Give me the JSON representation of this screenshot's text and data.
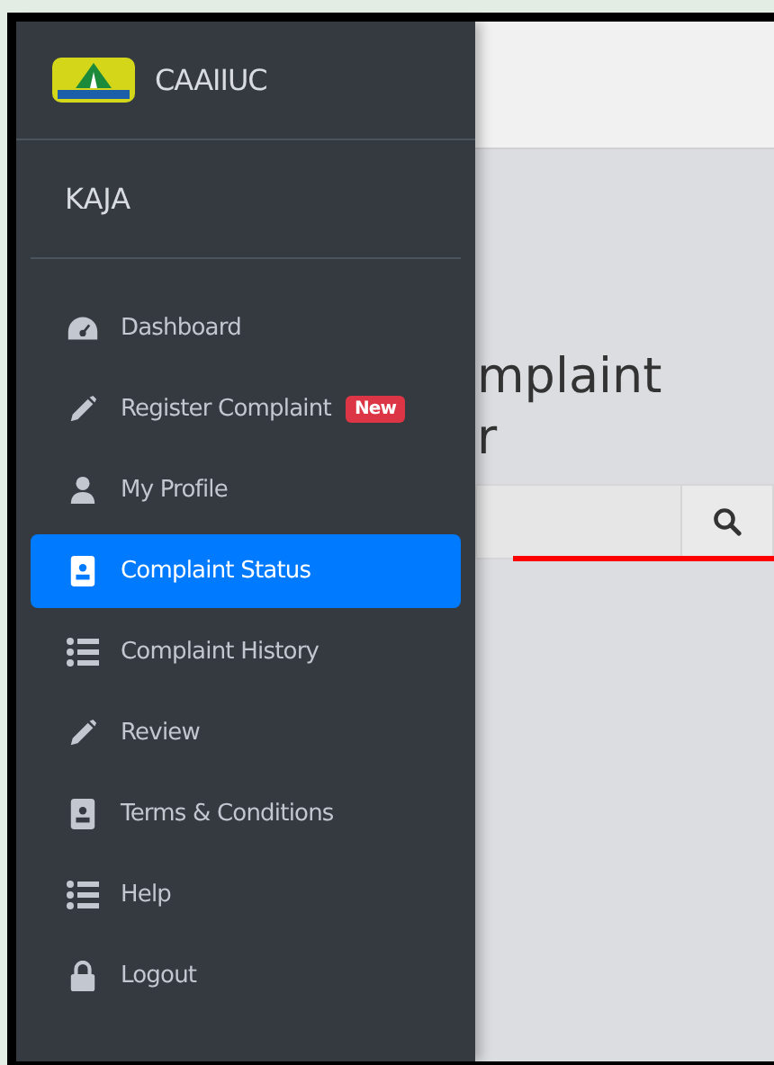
{
  "sidebar": {
    "brand": "CAAIIUC",
    "user": "KAJA",
    "items": [
      {
        "kind": "gauge",
        "label": "Dashboard",
        "selected": false
      },
      {
        "kind": "pencil",
        "label": "Register Complaint",
        "badge": "New",
        "selected": false
      },
      {
        "kind": "user",
        "label": "My Profile",
        "selected": false
      },
      {
        "kind": "card",
        "label": "Complaint Status",
        "selected": true
      },
      {
        "kind": "list",
        "label": "Complaint History",
        "selected": false
      },
      {
        "kind": "pencil",
        "label": "Review",
        "selected": false
      },
      {
        "kind": "card",
        "label": "Terms & Conditions",
        "selected": false
      },
      {
        "kind": "list",
        "label": "Help",
        "selected": false
      },
      {
        "kind": "lock",
        "label": "Logout",
        "selected": false
      }
    ]
  },
  "main": {
    "heading_lines": [
      "mplaint",
      "r"
    ]
  }
}
